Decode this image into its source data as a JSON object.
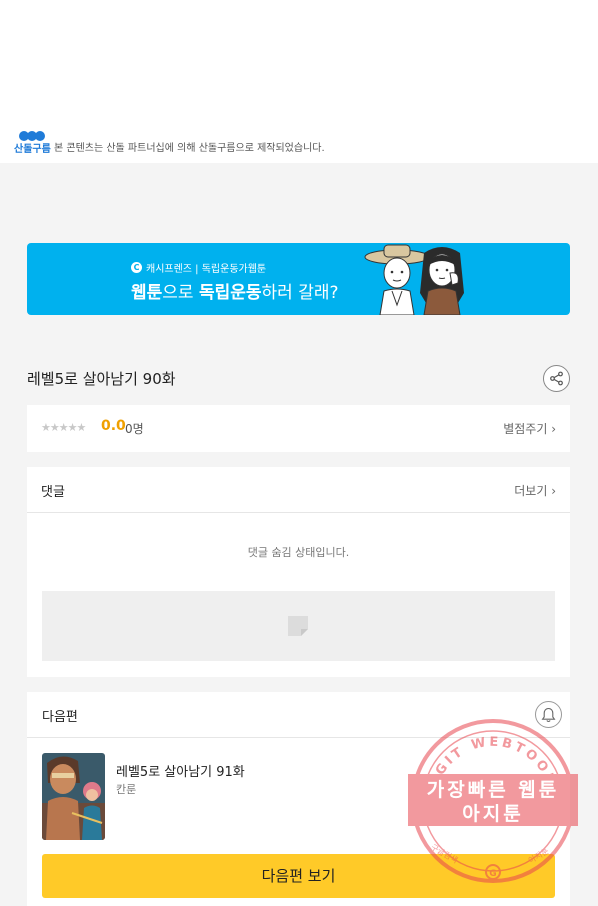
{
  "notice": {
    "brand": "산돌구름",
    "text": "본 콘텐츠는 산돌 파트너십에 의해 산돌구름으로 제작되었습니다."
  },
  "banner": {
    "small_text": "캐시프렌즈 | 독립운동가웹툰",
    "big_text_a": "웹툰",
    "big_text_b": "으로 ",
    "big_text_c": "독립운동",
    "big_text_d": "하러 갈래?"
  },
  "episode": {
    "title": "레벨5로 살아남기 90화"
  },
  "rating": {
    "stars": "★★★★★",
    "score": "0.0",
    "count": "0명",
    "rate_link": "별점주기 ›"
  },
  "comments": {
    "label": "댓글",
    "more": "더보기 ›",
    "hidden_msg": "댓글 숨김 상태입니다."
  },
  "next_episode": {
    "label": "다음편",
    "title": "레벨5로 살아남기 91화",
    "author": "칸룬",
    "button": "다음편 보기"
  },
  "stamp": {
    "arc_text": "AGIT WEBTOON",
    "line1": "가장빠른 웹툰",
    "line2": "아지툰",
    "bottom_left": "구글검색",
    "bottom_right": "아지툰",
    "color": "#e8474f"
  },
  "colors": {
    "banner_bg": "#00b1ee",
    "accent_score": "#f0a000",
    "next_button": "#ffca28",
    "brand_blue": "#1f7bd8"
  }
}
